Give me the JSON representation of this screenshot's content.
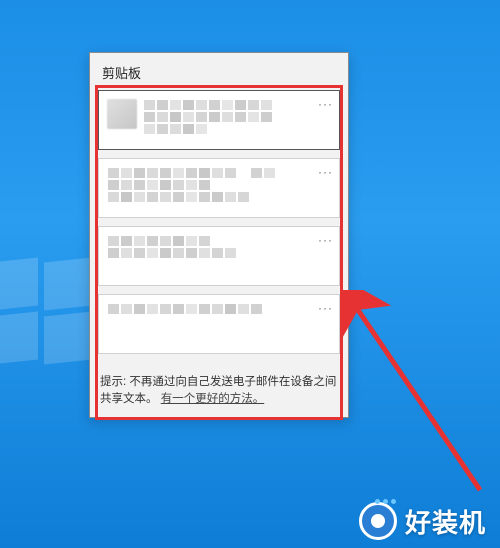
{
  "panel": {
    "title": "剪贴板",
    "items": [
      {
        "more": "···",
        "selected": true
      },
      {
        "more": "···",
        "selected": false
      },
      {
        "more": "···",
        "selected": false
      },
      {
        "more": "···",
        "selected": false
      }
    ],
    "tip_prefix": "提示: ",
    "tip_body": "不再通过向自己发送电子邮件在设备之间共享文本。",
    "tip_link": "有一个更好的方法。"
  },
  "watermark": {
    "text": "好装机"
  }
}
